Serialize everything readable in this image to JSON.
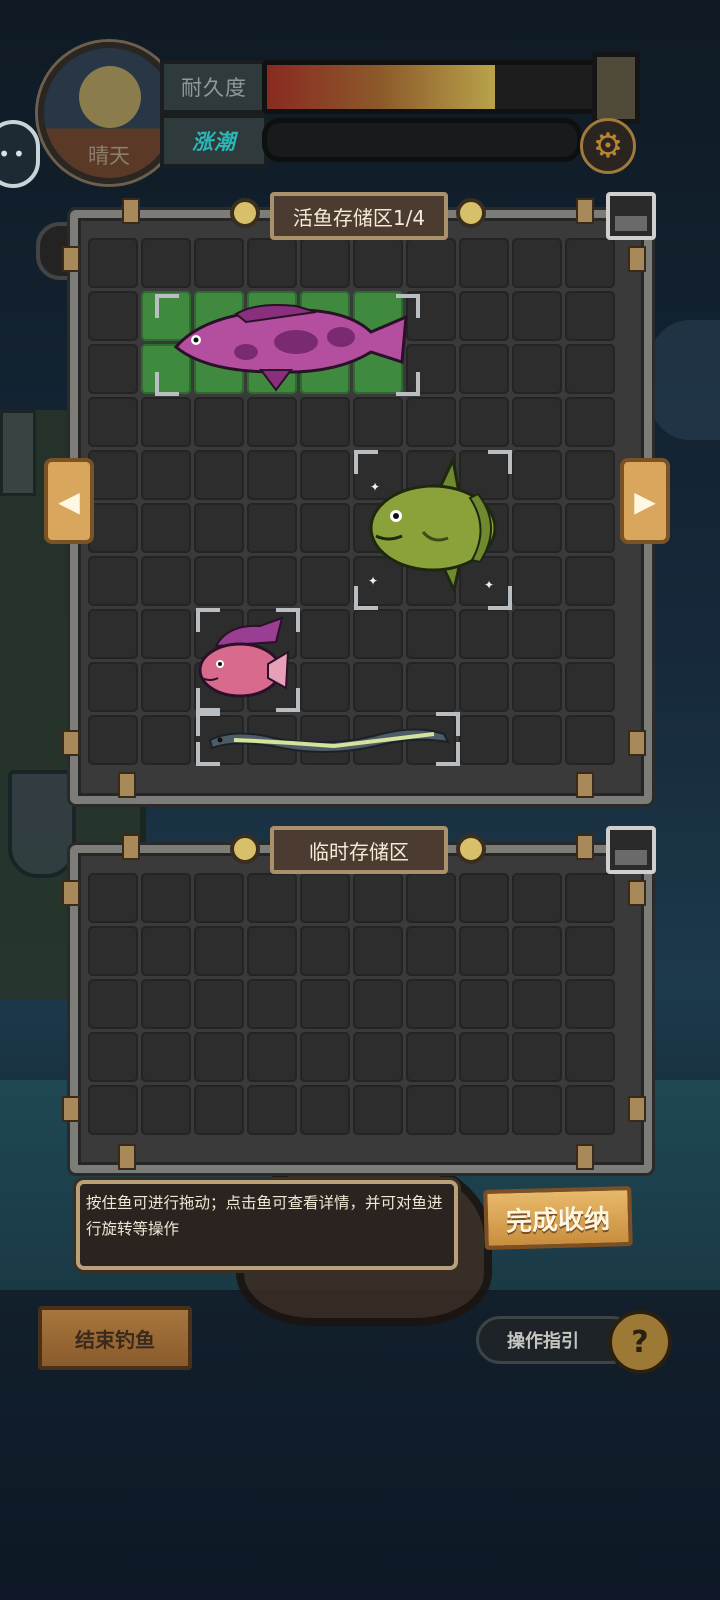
{
  "hud": {
    "weather": "晴天",
    "durability_label": "耐久度",
    "durability_level": 0.68,
    "tide_label": "涨潮",
    "settings_icon": "gear-icon"
  },
  "live_storage": {
    "title": "活鱼存储区1/4",
    "rows": 10,
    "cols": 10,
    "fish": [
      {
        "name": "purple-grouper",
        "color": "#b44fa0"
      },
      {
        "name": "green-sunfish",
        "color": "#7c9a3a"
      },
      {
        "name": "pink-fish",
        "color": "#d86a8e"
      },
      {
        "name": "eel",
        "color": "#c8d88a"
      }
    ]
  },
  "temp_storage": {
    "title": "临时存储区",
    "rows": 5,
    "cols": 10
  },
  "hint": "按住鱼可进行拖动；点击鱼可查看详情，并可对鱼进行旋转等操作",
  "buttons": {
    "done": "完成收纳",
    "end_fishing": "结束钓鱼",
    "guide": "操作指引",
    "guide_icon": "?"
  },
  "colors": {
    "occupied_cell": "#3f8a3e",
    "accent_wood": "#d9a65e"
  }
}
